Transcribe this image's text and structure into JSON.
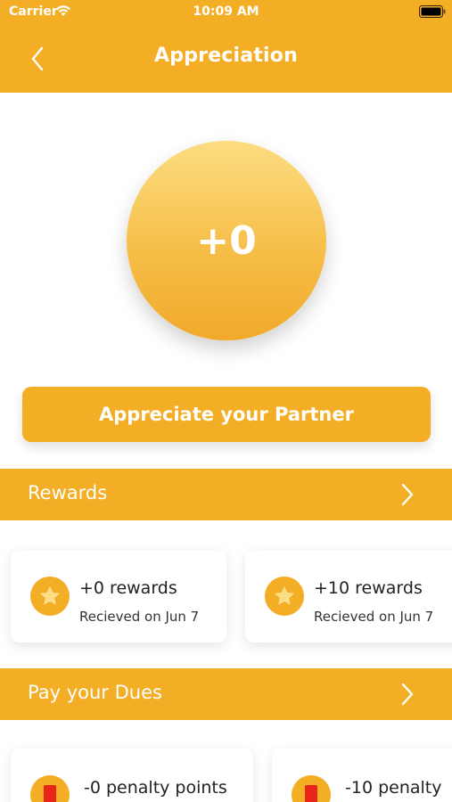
{
  "status_bar": {
    "carrier": "Carrier",
    "time": "10:09 AM"
  },
  "header": {
    "title": "Appreciation",
    "back_icon": "chevron-left-icon"
  },
  "score": {
    "value": "+0"
  },
  "appreciate_button": {
    "label": "Appreciate your Partner"
  },
  "rewards": {
    "title": "Rewards",
    "items": [
      {
        "title": "+0 rewards",
        "subtitle": "Recieved on Jun 7"
      },
      {
        "title": "+10 rewards",
        "subtitle": "Recieved on Jun 7"
      }
    ]
  },
  "dues": {
    "title": "Pay your Dues",
    "items": [
      {
        "title": "-0 penalty points"
      },
      {
        "title": "-10 penalty"
      }
    ]
  },
  "colors": {
    "accent": "#F3AE25",
    "background": "#FFFFFF",
    "penalty_icon": "#E8251B"
  }
}
